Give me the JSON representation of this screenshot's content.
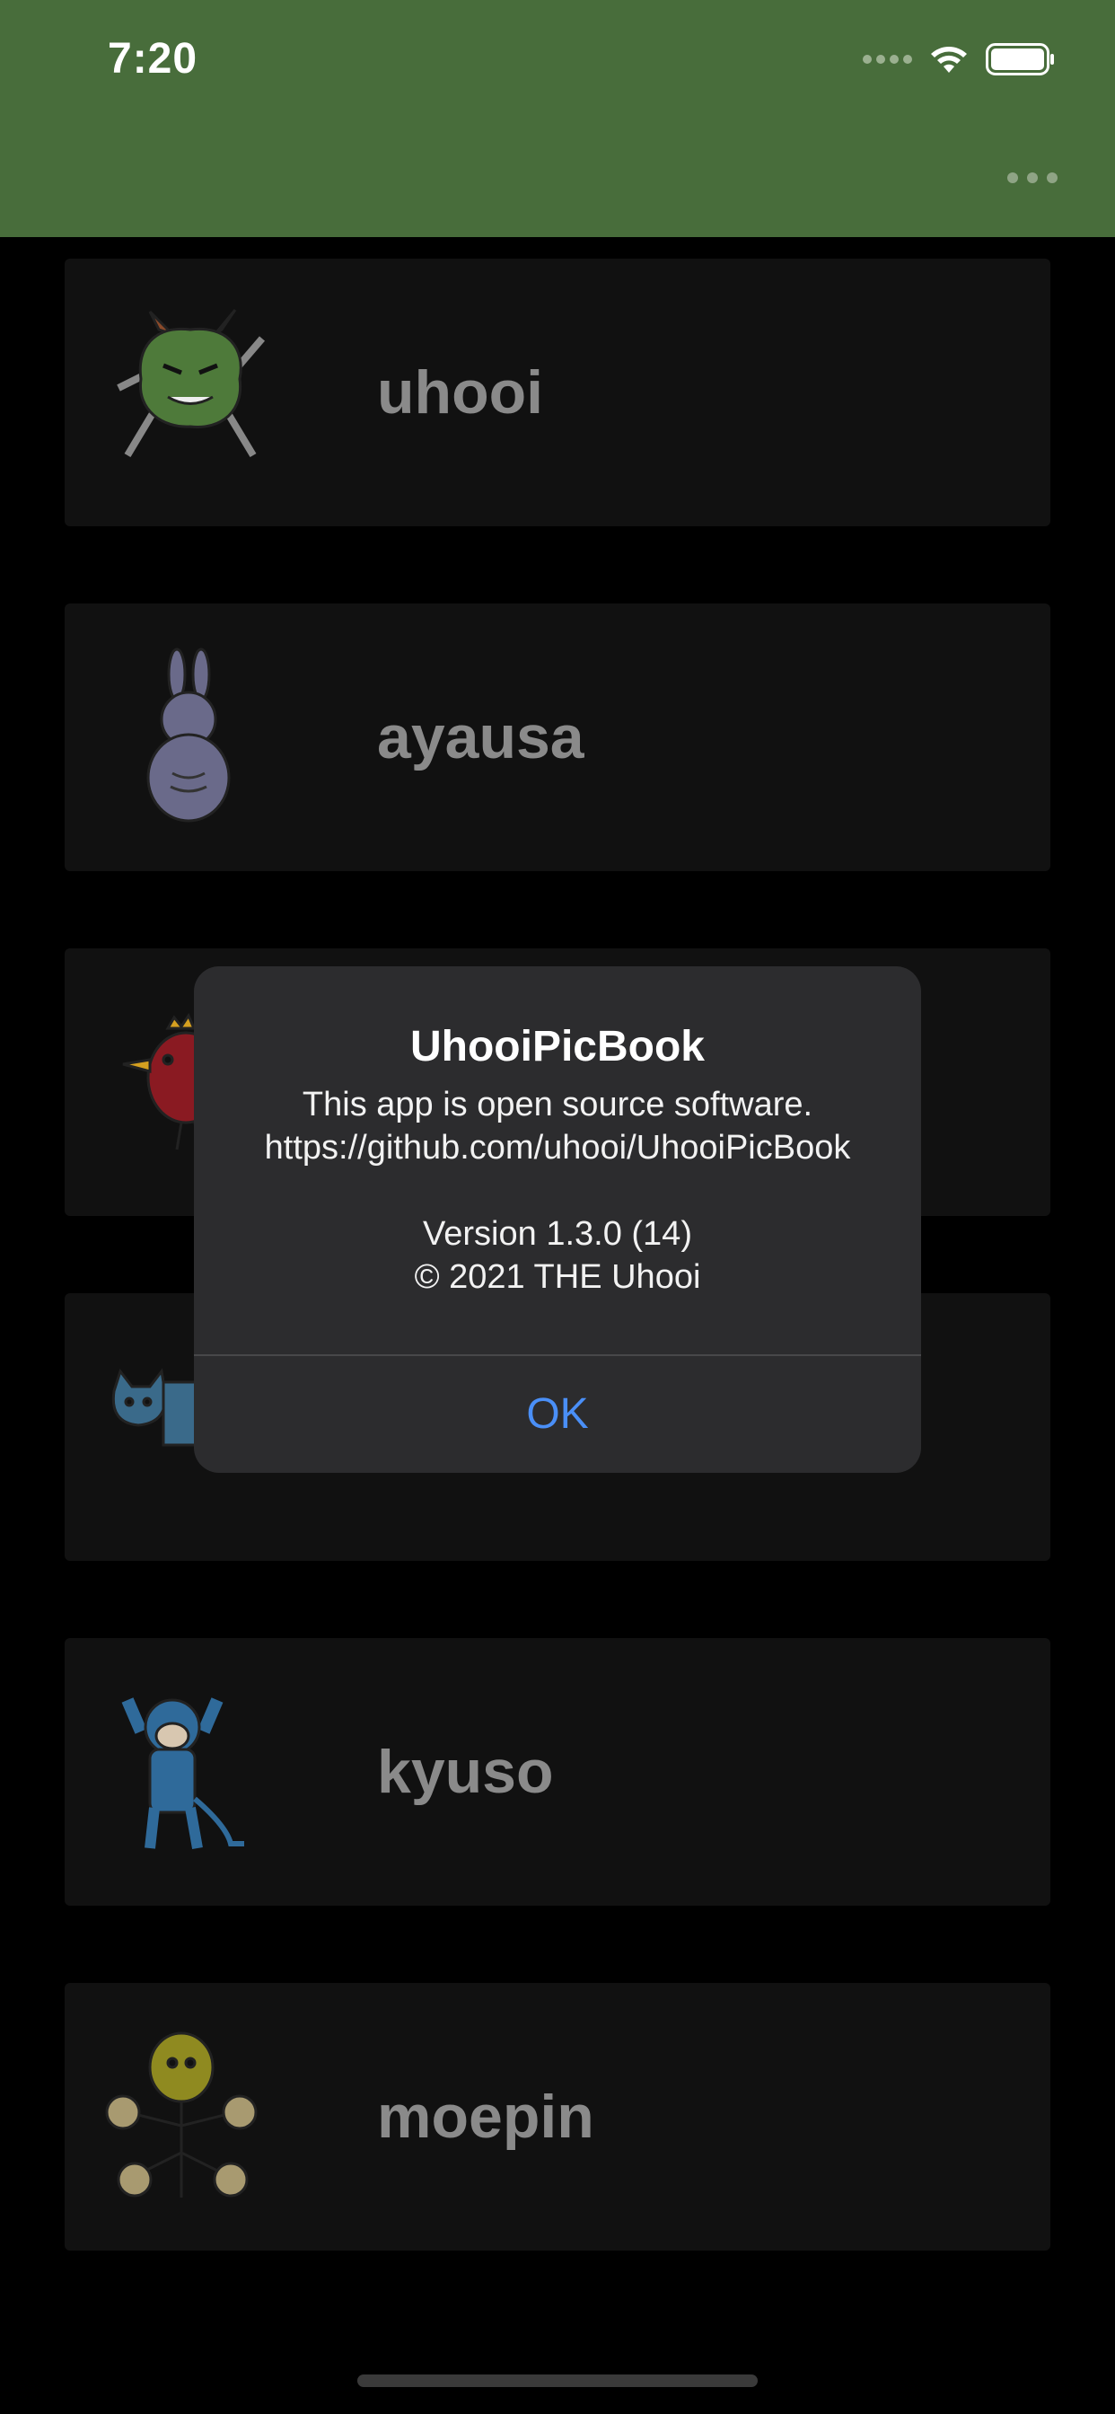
{
  "status_bar": {
    "time": "7:20"
  },
  "nav": {
    "more_icon": "ellipsis-icon"
  },
  "list": {
    "items": [
      {
        "name": "uhooi",
        "icon": "uhooi-monster-icon"
      },
      {
        "name": "ayausa",
        "icon": "rabbit-icon"
      },
      {
        "name": "",
        "icon": "bird-icon"
      },
      {
        "name": "",
        "icon": "cat-icon"
      },
      {
        "name": "kyuso",
        "icon": "blue-mouse-icon"
      },
      {
        "name": "moepin",
        "icon": "yellow-creature-icon"
      }
    ]
  },
  "alert": {
    "title": "UhooiPicBook",
    "message": "This app is open source software.\nhttps://github.com/uhooi/UhooiPicBook\n\nVersion 1.3.0 (14)\n© 2021 THE Uhooi",
    "ok_label": "OK",
    "ok_color": "#4a8ff7"
  },
  "colors": {
    "nav_background": "#486d3b",
    "card_background": "#111111",
    "alert_background": "#2c2c2e"
  }
}
